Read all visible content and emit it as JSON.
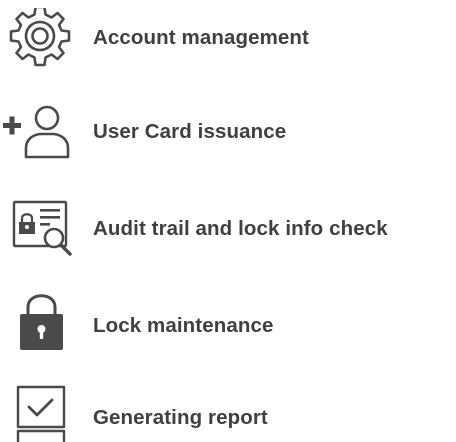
{
  "features": [
    {
      "icon": "gear-icon",
      "label": "Account management"
    },
    {
      "icon": "add-user-icon",
      "label": "User Card issuance"
    },
    {
      "icon": "audit-lock-search-icon",
      "label": "Audit trail and lock info check"
    },
    {
      "icon": "padlock-icon",
      "label": "Lock maintenance"
    },
    {
      "icon": "report-checkbox-icon",
      "label": "Generating report"
    }
  ],
  "colors": {
    "text": "#404040",
    "icon": "#4a4a4a",
    "background": "#ffffff"
  }
}
